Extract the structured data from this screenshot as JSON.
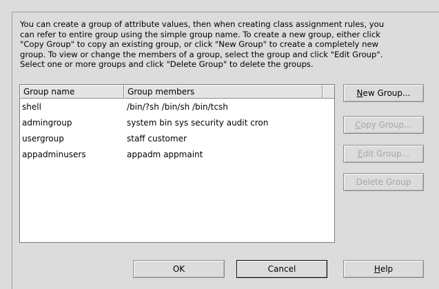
{
  "description_lines": [
    "You can create a group of attribute values, then when creating class assignment rules, you",
    "can refer to entire group using the simple group name. To create a new group, either click",
    "\"Copy Group\" to copy an existing group, or click \"New Group\" to create a completely new",
    "group. To view or change the members of a group, select the group and click \"Edit Group\".",
    "Select one or more groups and click \"Delete Group\" to delete the groups."
  ],
  "table": {
    "headers": [
      "Group name",
      "Group members"
    ],
    "rows": [
      {
        "name": "shell",
        "members": "/bin/?sh /bin/sh /bin/tcsh"
      },
      {
        "name": "admingroup",
        "members": "system bin sys security audit cron"
      },
      {
        "name": "usergroup",
        "members": "staff customer"
      },
      {
        "name": "appadminusers",
        "members": "appadm appmaint"
      }
    ]
  },
  "buttons": {
    "new_group": {
      "mnemonic": "N",
      "rest": "ew Group..."
    },
    "copy_group": {
      "mnemonic": "C",
      "rest": "opy Group..."
    },
    "edit_group": {
      "mnemonic": "E",
      "rest": "dit Group..."
    },
    "delete_group": "Delete Group",
    "ok": "OK",
    "cancel": "Cancel",
    "help": {
      "mnemonic": "H",
      "rest": "elp"
    }
  }
}
